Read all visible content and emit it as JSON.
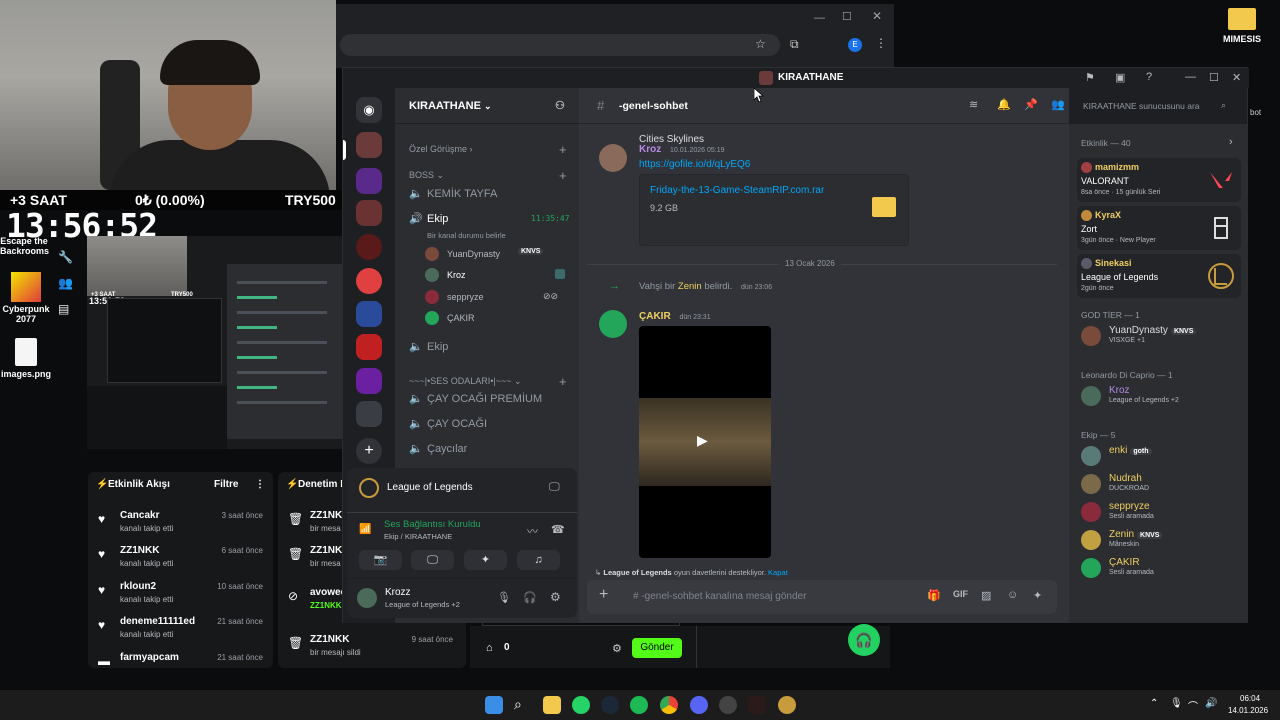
{
  "overlay": {
    "hours_label": "+3 SAAT",
    "balance": "0₺ (0.00%)",
    "currency_goal": "TRY500",
    "clock": "13:56:52",
    "mini_clock": "13:56:59",
    "mini_hours": "+3 SAAT",
    "mini_goal": "TRY500"
  },
  "desktop": {
    "icons": [
      {
        "label": "Escape the Backrooms"
      },
      {
        "label": "Cyberpunk 2077"
      },
      {
        "label": "images.png"
      },
      {
        "label": "MIMESIS"
      }
    ]
  },
  "activity_feed": {
    "title": "Etkinlik Akışı",
    "filter_label": "Filtre",
    "items": [
      {
        "name": "Cancakr",
        "sub": "kanalı takip etti",
        "time": "3 saat önce"
      },
      {
        "name": "ZZ1NKK",
        "sub": "kanalı takip etti",
        "time": "6 saat önce"
      },
      {
        "name": "rkloun2",
        "sub": "kanalı takip etti",
        "time": "10 saat önce"
      },
      {
        "name": "deneme11111ed",
        "sub": "kanalı takip etti",
        "time": "21 saat önce"
      },
      {
        "name": "farmyapcam",
        "sub": "",
        "time": "21 saat önce"
      }
    ]
  },
  "audit_feed": {
    "title": "Denetim E",
    "items": [
      {
        "name": "ZZ1NK",
        "sub": "bir mesa",
        "time": ""
      },
      {
        "name": "ZZ1NK",
        "sub": "bir mesa",
        "time": ""
      },
      {
        "name": "avowed",
        "sub": "ZZ1NKK",
        "time": ""
      },
      {
        "name": "ZZ1NKK",
        "sub": "bir mesajı sildi",
        "time": "9 saat önce"
      }
    ]
  },
  "chat_bar": {
    "count": "0",
    "send_label": "Gönder"
  },
  "discord": {
    "window_title": "KIRAATHANE",
    "server_name": "KIRAATHANE",
    "channel_name": "-genel-sohbet",
    "search_placeholder": "KIRAATHANE sunucusunu ara",
    "categories": [
      {
        "label": "Özel Görüşme"
      },
      {
        "label": "BOSS"
      },
      {
        "label": "~~~|•SES ODALARI•|~~~"
      }
    ],
    "channels": [
      {
        "label": "KEMİK TAYFA"
      },
      {
        "label": "Ekip",
        "timer": "11:35:47",
        "status": "Bir kanal durumu belirle"
      },
      {
        "label": "Ekip"
      },
      {
        "label": "ÇAY OCAĞI PREMİUM"
      },
      {
        "label": "ÇAY OCAĞI"
      },
      {
        "label": "Çaycılar"
      }
    ],
    "voice_users": [
      {
        "name": "YuanDynasty",
        "tag": "KNVS"
      },
      {
        "name": "Kroz"
      },
      {
        "name": "seppryze"
      },
      {
        "name": "ÇAKIR"
      }
    ],
    "voice_panel": {
      "activity": "League of Legends",
      "status": "Ses Bağlantısı Kuruldu",
      "channel": "Ekip / KIRAATHANE",
      "user": "Krozz",
      "user_activity": "League of Legends +2"
    },
    "messages": {
      "prev_text": "Cities Skylines",
      "m1_author": "Kroz",
      "m1_time": "10.01.2026 05:19",
      "m1_link": "https://gofile.io/d/qLyEQ6",
      "file_name": "Friday-the-13-Game-SteamRIP.com.rar",
      "file_size": "9.2 GB",
      "divider": "13 Ocak 2026",
      "join_prefix": "Vahşi bir",
      "join_name": "Zenin",
      "join_suffix": "belirdi.",
      "join_time": "dün 23:06",
      "m2_author": "ÇAKIR",
      "m2_time": "dün 23:31",
      "invite_game": "League of Legends",
      "invite_text": "oyun davetlerini destekliyor.",
      "invite_close": "Kapat",
      "input_placeholder": "# -genel-sohbet kanalına mesaj gönder"
    },
    "members": {
      "activity_header": "Etkinlik — 40",
      "activities": [
        {
          "user": "mamizmm",
          "game": "VALORANT",
          "meta": "8sa önce · 15 günlük Seri",
          "color": "#ff4655"
        },
        {
          "user": "KyraX",
          "game": "Zort",
          "meta": "3gün önce · New Player",
          "color": "#dddddd"
        },
        {
          "user": "Sinekasi",
          "game": "League of Legends",
          "meta": "2gün önce",
          "color": "#c89b3c"
        }
      ],
      "groups": [
        {
          "title": "GOD TİER — 1",
          "members": [
            {
              "name": "YuanDynasty",
              "tag": "KNVS",
              "sub": "VISXGE +1",
              "color": "#dbdee1"
            }
          ]
        },
        {
          "title": "Leonardo Di Caprio — 1",
          "members": [
            {
              "name": "Kroz",
              "sub": "League of Legends +2",
              "color": "#b78ae6"
            }
          ]
        },
        {
          "title": "Ekip — 5",
          "members": [
            {
              "name": "enki",
              "tag": "goth",
              "sub": "",
              "color": "#f0d060"
            },
            {
              "name": "Nudrah",
              "sub": "DUCKROAD",
              "color": "#f0d060"
            },
            {
              "name": "seppryze",
              "sub": "Sesli aramada",
              "color": "#f0d060"
            },
            {
              "name": "Zenin",
              "tag": "KNVS",
              "sub": "Mâneskin",
              "color": "#f0d060"
            },
            {
              "name": "ÇAKIR",
              "sub": "Sesli aramada",
              "color": "#f0d060"
            }
          ]
        }
      ]
    }
  },
  "taskbar": {
    "time": "06:04",
    "date": "14.01.2026"
  }
}
